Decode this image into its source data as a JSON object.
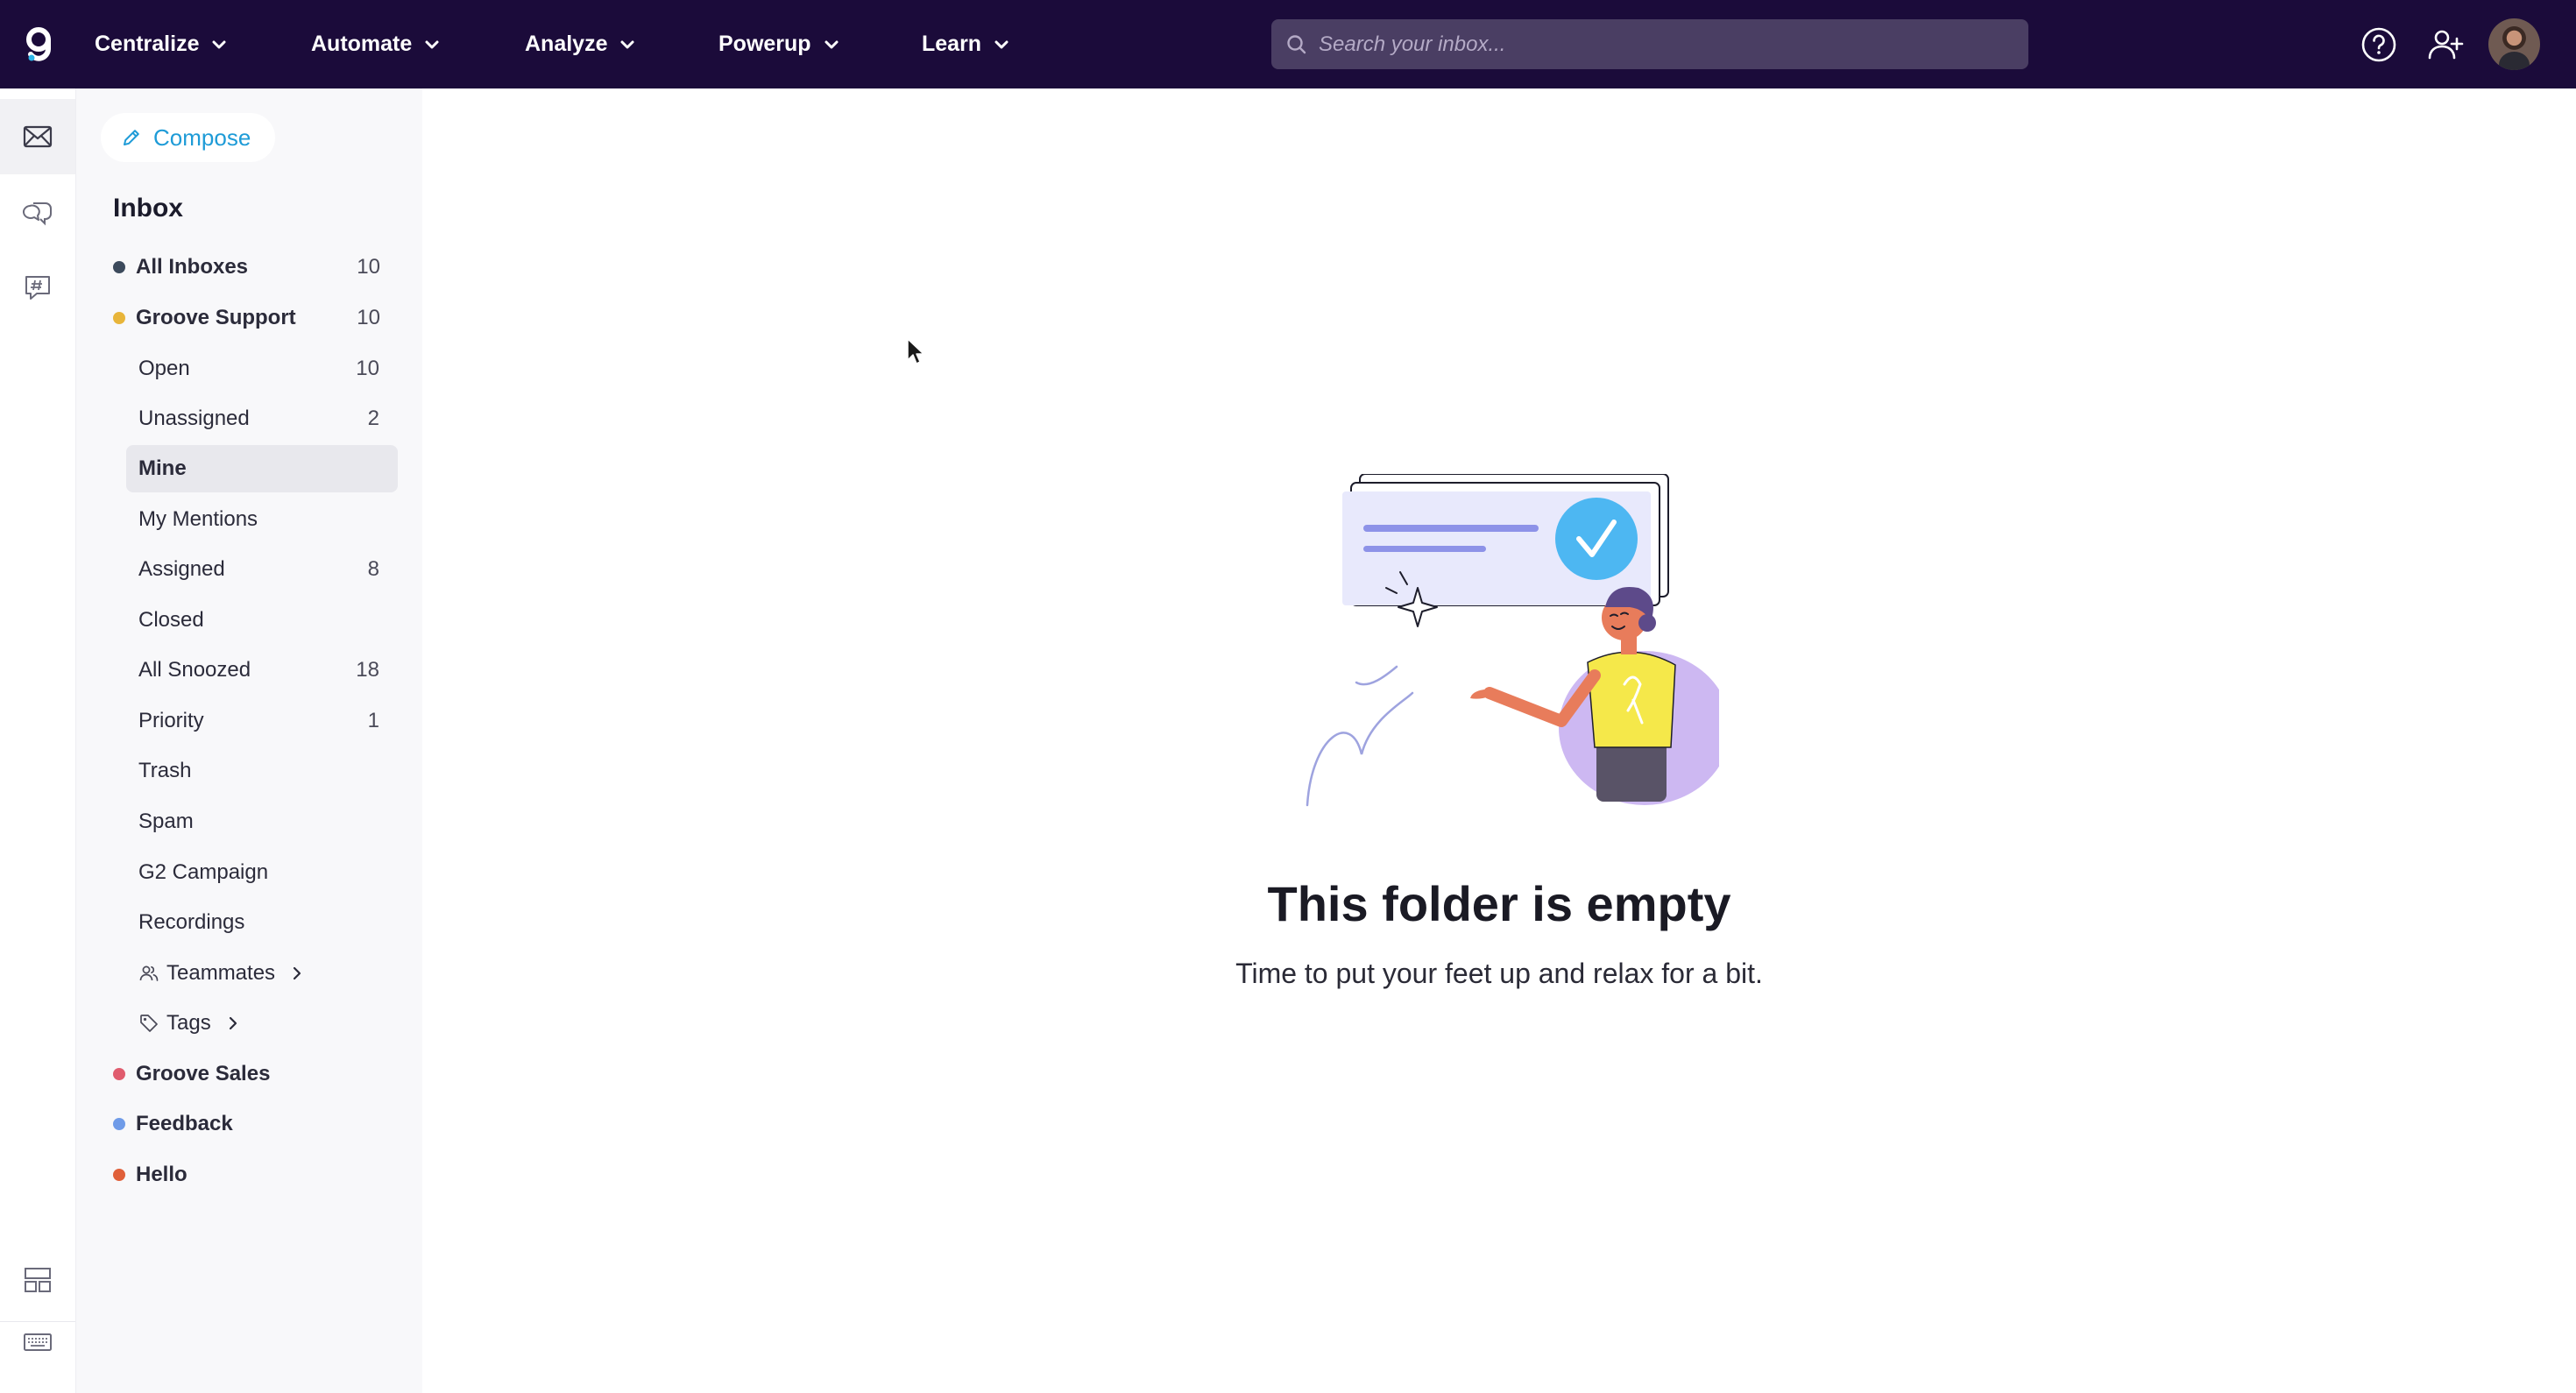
{
  "topbar": {
    "logo_icon": "groove-logo-icon",
    "nav": [
      {
        "label": "Centralize"
      },
      {
        "label": "Automate"
      },
      {
        "label": "Analyze"
      },
      {
        "label": "Powerup"
      },
      {
        "label": "Learn"
      }
    ],
    "search_placeholder": "Search your inbox...",
    "icons": [
      "help-icon",
      "add-user-icon"
    ],
    "background_color": "#1b0b3a"
  },
  "rail": {
    "top_icons": [
      "mail-icon",
      "chat-icon",
      "channel-icon"
    ],
    "bottom_icons": [
      "layout-icon",
      "keyboard-icon"
    ]
  },
  "sidebar": {
    "compose_label": "Compose",
    "section_title": "Inbox",
    "all_inboxes": {
      "label": "All Inboxes",
      "count": "10",
      "color": "#3c4a5c"
    },
    "groove_support": {
      "label": "Groove Support",
      "count": "10",
      "color": "#e8b53a"
    },
    "folders": [
      {
        "label": "Open",
        "count": "10"
      },
      {
        "label": "Unassigned",
        "count": "2"
      },
      {
        "label": "Mine",
        "count": ""
      },
      {
        "label": "My Mentions",
        "count": ""
      },
      {
        "label": "Assigned",
        "count": "8"
      },
      {
        "label": "Closed",
        "count": ""
      },
      {
        "label": "All Snoozed",
        "count": "18"
      },
      {
        "label": "Priority",
        "count": "1"
      },
      {
        "label": "Trash",
        "count": ""
      },
      {
        "label": "Spam",
        "count": ""
      },
      {
        "label": "G2 Campaign",
        "count": ""
      },
      {
        "label": "Recordings",
        "count": ""
      }
    ],
    "selected_folder": "Mine",
    "teammates_label": "Teammates",
    "tags_label": "Tags",
    "other_inboxes": [
      {
        "label": "Groove Sales",
        "color": "#e05c6e"
      },
      {
        "label": "Feedback",
        "color": "#6f9be8"
      },
      {
        "label": "Hello",
        "color": "#e0603a"
      }
    ]
  },
  "main": {
    "empty_title": "This folder is empty",
    "empty_subtitle": "Time to put your feet up and relax for a bit."
  }
}
